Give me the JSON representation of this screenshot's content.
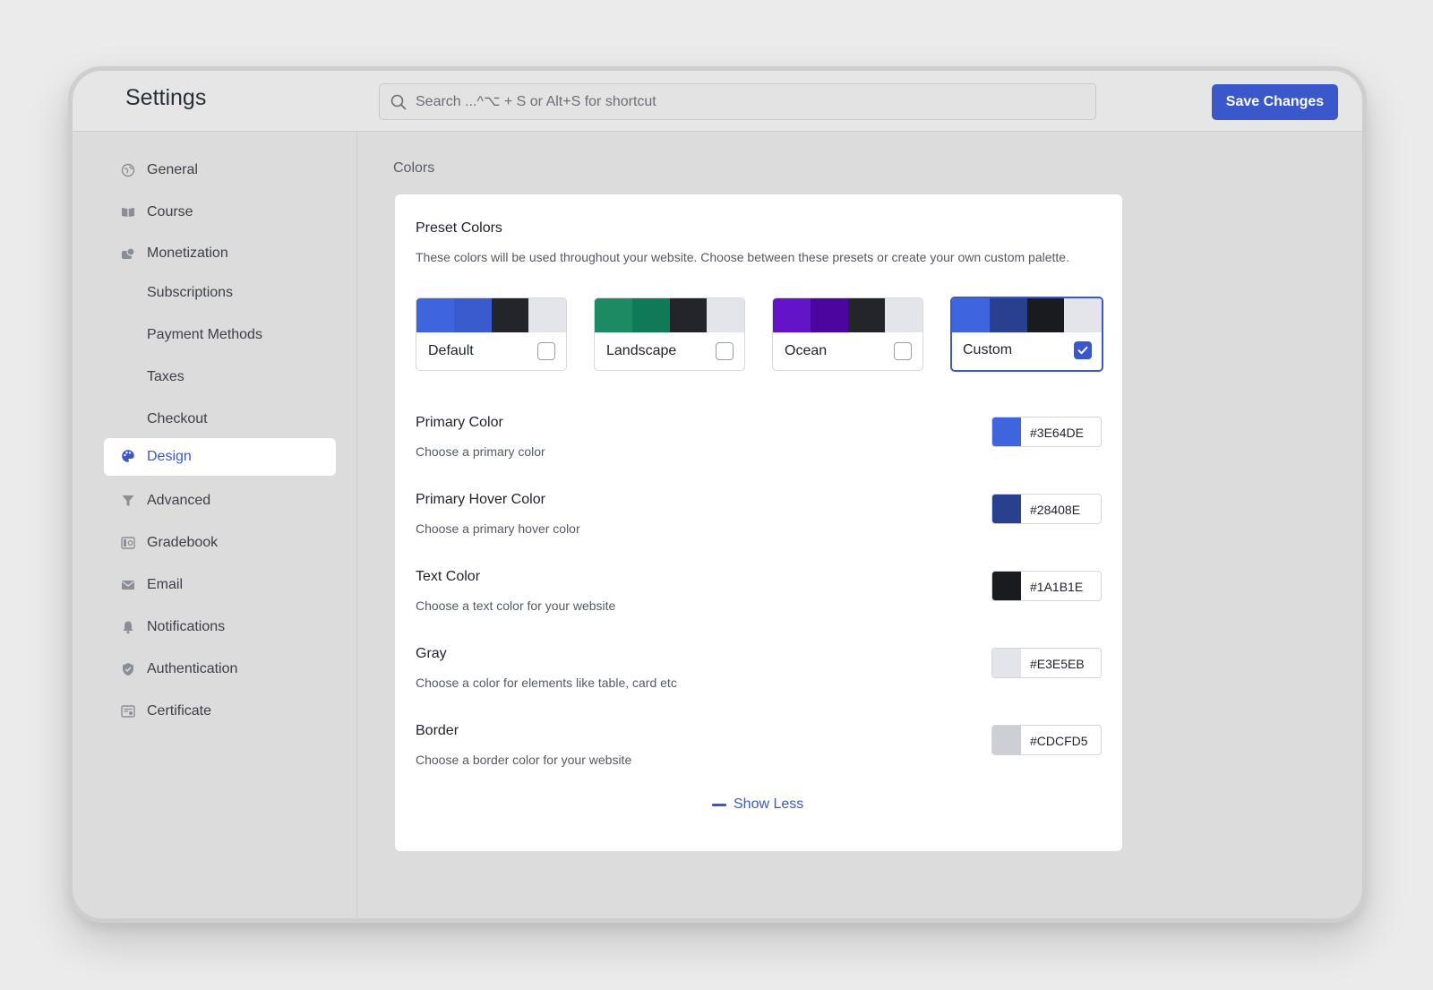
{
  "app": {
    "title": "Settings"
  },
  "search": {
    "placeholder": "Search ...^⌥ + S or Alt+S for shortcut"
  },
  "toolbar": {
    "save_label": "Save Changes"
  },
  "sidebar": {
    "items": [
      {
        "label": "General",
        "icon": "globe-icon",
        "active": false
      },
      {
        "label": "Course",
        "icon": "book-icon",
        "active": false
      },
      {
        "label": "Monetization",
        "icon": "coins-icon",
        "active": false
      },
      {
        "label": "Subscriptions",
        "icon": "",
        "active": false
      },
      {
        "label": "Payment Methods",
        "icon": "",
        "active": false
      },
      {
        "label": "Taxes",
        "icon": "",
        "active": false
      },
      {
        "label": "Checkout",
        "icon": "",
        "active": false
      },
      {
        "label": "Design",
        "icon": "palette-icon",
        "active": true
      },
      {
        "label": "Advanced",
        "icon": "filter-icon",
        "active": false
      },
      {
        "label": "Gradebook",
        "icon": "gradebook-icon",
        "active": false
      },
      {
        "label": "Email",
        "icon": "envelope-icon",
        "active": false
      },
      {
        "label": "Notifications",
        "icon": "bell-icon",
        "active": false
      },
      {
        "label": "Authentication",
        "icon": "shield-icon",
        "active": false
      },
      {
        "label": "Certificate",
        "icon": "certificate-icon",
        "active": false
      }
    ]
  },
  "main": {
    "section_title": "Colors",
    "card": {
      "title": "Preset Colors",
      "description": "These colors will be used throughout your website. Choose between these presets or create your own custom palette.",
      "presets": [
        {
          "label": "Default",
          "selected": false,
          "swatches": [
            "#3E64DE",
            "#3A5BCE",
            "#23252B",
            "#E3E5EB"
          ]
        },
        {
          "label": "Landscape",
          "selected": false,
          "swatches": [
            "#1E8A64",
            "#107A58",
            "#23252B",
            "#E3E5EB"
          ]
        },
        {
          "label": "Ocean",
          "selected": false,
          "swatches": [
            "#6414C8",
            "#4A069E",
            "#23252B",
            "#E3E5EB"
          ]
        },
        {
          "label": "Custom",
          "selected": true,
          "swatches": [
            "#3E64DE",
            "#28408E",
            "#1A1B1E",
            "#E3E5EB"
          ]
        }
      ],
      "colors": [
        {
          "label": "Primary Color",
          "description": "Choose a primary color",
          "value": "#3E64DE"
        },
        {
          "label": "Primary Hover Color",
          "description": "Choose a primary hover color",
          "value": "#28408E"
        },
        {
          "label": "Text Color",
          "description": "Choose a text color for your website",
          "value": "#1A1B1E"
        },
        {
          "label": "Gray",
          "description": "Choose a color for elements like table, card etc",
          "value": "#E3E5EB"
        },
        {
          "label": "Border",
          "description": "Choose a border color for your website",
          "value": "#CDCFD5"
        }
      ],
      "show_less_label": "Show Less"
    }
  },
  "theme": {
    "accent": "#3A58C9"
  }
}
